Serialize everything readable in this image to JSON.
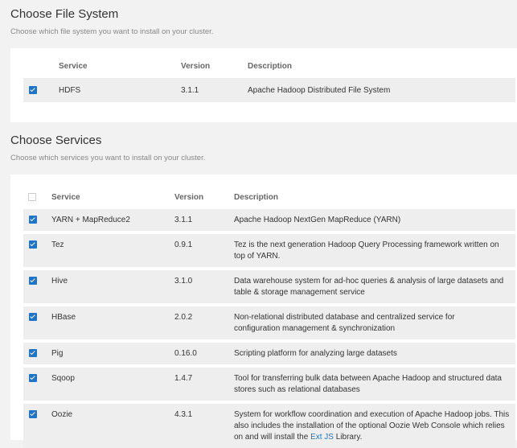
{
  "file_system": {
    "title": "Choose File System",
    "subtitle": "Choose which file system you want to install on your cluster.",
    "headers": {
      "service": "Service",
      "version": "Version",
      "description": "Description"
    },
    "rows": [
      {
        "checked": true,
        "service": "HDFS",
        "version": "3.1.1",
        "description": "Apache Hadoop Distributed File System"
      }
    ]
  },
  "services": {
    "title": "Choose Services",
    "subtitle": "Choose which services you want to install on your cluster.",
    "select_all_checked": false,
    "headers": {
      "service": "Service",
      "version": "Version",
      "description": "Description"
    },
    "rows": [
      {
        "checked": true,
        "service": "YARN + MapReduce2",
        "version": "3.1.1",
        "description": "Apache Hadoop NextGen MapReduce (YARN)"
      },
      {
        "checked": true,
        "service": "Tez",
        "version": "0.9.1",
        "description": "Tez is the next generation Hadoop Query Processing framework written on top of YARN."
      },
      {
        "checked": true,
        "service": "Hive",
        "version": "3.1.0",
        "description": "Data warehouse system for ad-hoc queries & analysis of large datasets and table & storage management service"
      },
      {
        "checked": true,
        "service": "HBase",
        "version": "2.0.2",
        "description": "Non-relational distributed database and centralized service for configuration management & synchronization"
      },
      {
        "checked": true,
        "service": "Pig",
        "version": "0.16.0",
        "description": "Scripting platform for analyzing large datasets"
      },
      {
        "checked": true,
        "service": "Sqoop",
        "version": "1.4.7",
        "description": "Tool for transferring bulk data between Apache Hadoop and structured data stores such as relational databases"
      },
      {
        "checked": true,
        "service": "Oozie",
        "version": "4.3.1",
        "description": "System for workflow coordination and execution of Apache Hadoop jobs. This also includes the installation of the optional Oozie Web Console which relies on and will install the",
        "description_link": "Ext JS",
        "description_suffix": " Library."
      }
    ]
  },
  "colors": {
    "accent": "#1e75c8",
    "row_bg": "#eeeeee",
    "page_bg": "#f2f2f2"
  }
}
